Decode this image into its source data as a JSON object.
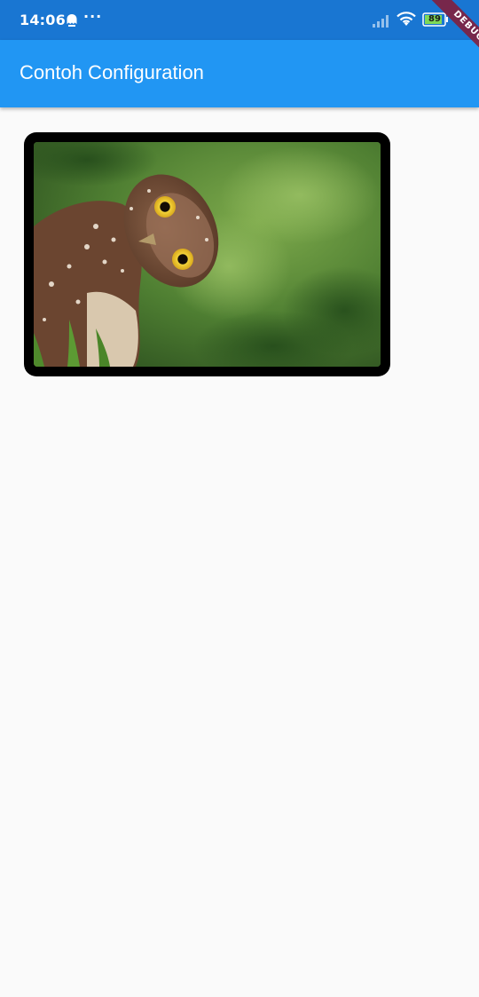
{
  "status_bar": {
    "time": "14:06",
    "more": "···",
    "battery_level": "89",
    "icons": [
      "notification-ghost-icon",
      "signal-icon",
      "wifi-icon",
      "battery-icon"
    ]
  },
  "app_bar": {
    "title": "Contoh Configuration"
  },
  "debug_banner": {
    "label": "DEBUG"
  },
  "content": {
    "image": {
      "subject": "owl"
    }
  },
  "colors": {
    "status_bar": "#1976d2",
    "app_bar": "#2196f3",
    "background": "#fafafa",
    "card_border": "#000000",
    "debug_ribbon": "#881a34"
  }
}
